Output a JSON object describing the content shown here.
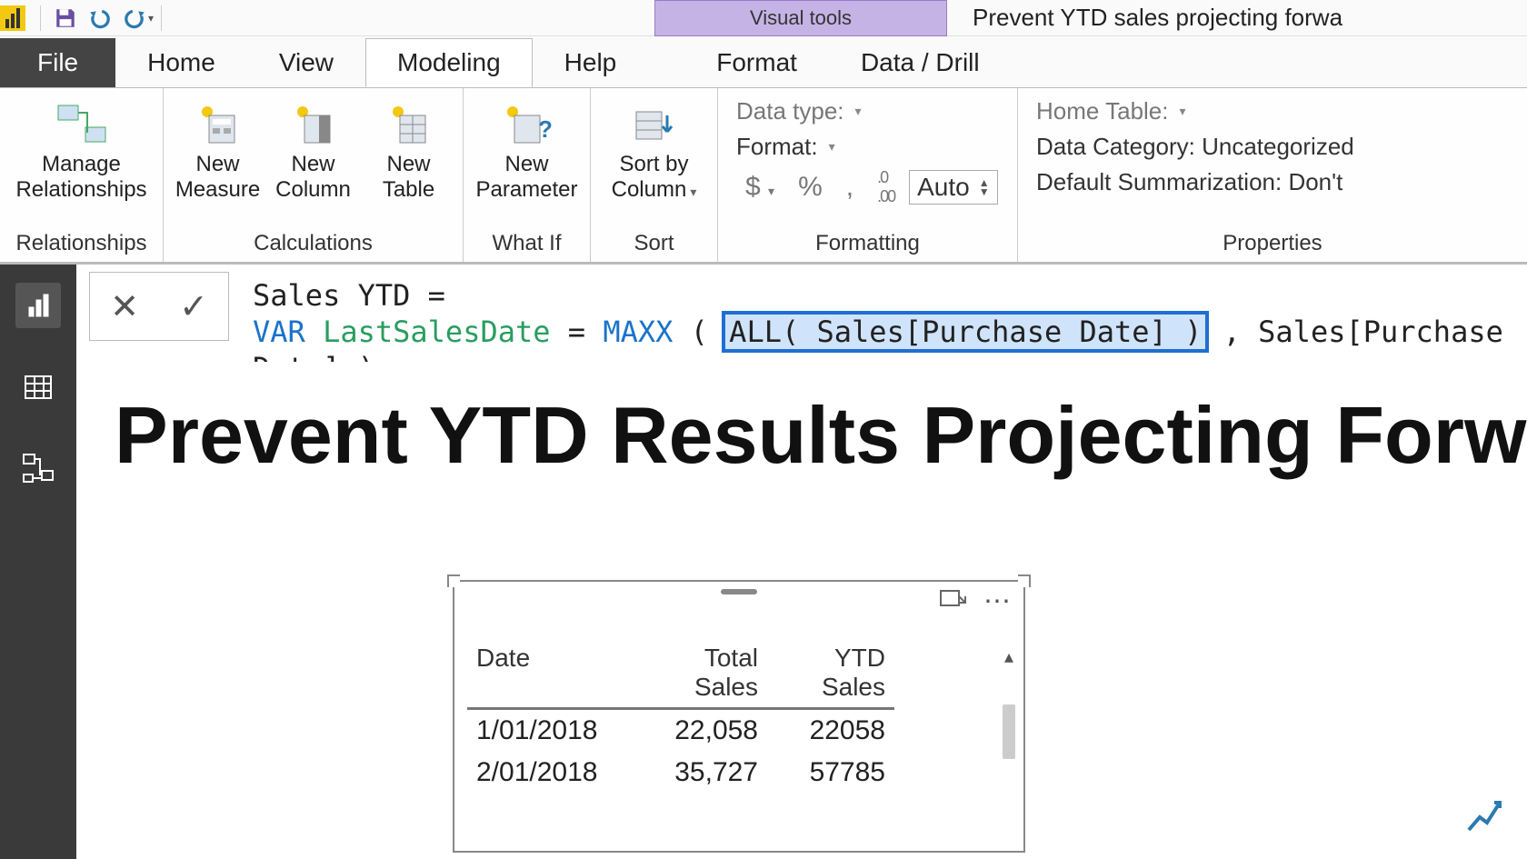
{
  "qat": {
    "app_name": "Power BI Desktop"
  },
  "context_tab": "Visual tools",
  "window_title": "Prevent YTD sales projecting forwa",
  "tabs": {
    "file": "File",
    "home": "Home",
    "view": "View",
    "modeling": "Modeling",
    "help": "Help",
    "format": "Format",
    "data_drill": "Data / Drill"
  },
  "ribbon": {
    "relationships": {
      "manage": "Manage\nRelationships",
      "group": "Relationships"
    },
    "calculations": {
      "measure": "New\nMeasure",
      "column": "New\nColumn",
      "table": "New\nTable",
      "group": "Calculations"
    },
    "whatif": {
      "param": "New\nParameter",
      "group": "What If"
    },
    "sort": {
      "sortby": "Sort by\nColumn",
      "group": "Sort"
    },
    "formatting": {
      "datatype": "Data type:",
      "format": "Format:",
      "currency": "$",
      "percent": "%",
      "comma": ",",
      "decimals_icon": ".00",
      "auto": "Auto",
      "group": "Formatting"
    },
    "properties": {
      "home_table": "Home Table:",
      "data_category": "Data Category: Uncategorized",
      "default_sum": "Default Summarization: Don't",
      "group": "Properties"
    }
  },
  "formula": {
    "line1_a": "Sales YTD = ",
    "var_kw": "VAR",
    "var_name": "LastSalesDate",
    "eq": " = ",
    "maxx": "MAXX",
    "open": "( ",
    "all_sel": "ALL( Sales[Purchase Date] )",
    "rest": ", Sales[Purchase Date] )"
  },
  "canvas": {
    "title": "Prevent YTD Results Projecting Forw"
  },
  "table": {
    "headers": {
      "date": "Date",
      "total": "Total Sales",
      "ytd": "YTD Sales"
    },
    "rows": [
      {
        "date": "1/01/2018",
        "total": "22,058",
        "ytd": "22058"
      },
      {
        "date": "2/01/2018",
        "total": "35,727",
        "ytd": "57785"
      }
    ]
  }
}
